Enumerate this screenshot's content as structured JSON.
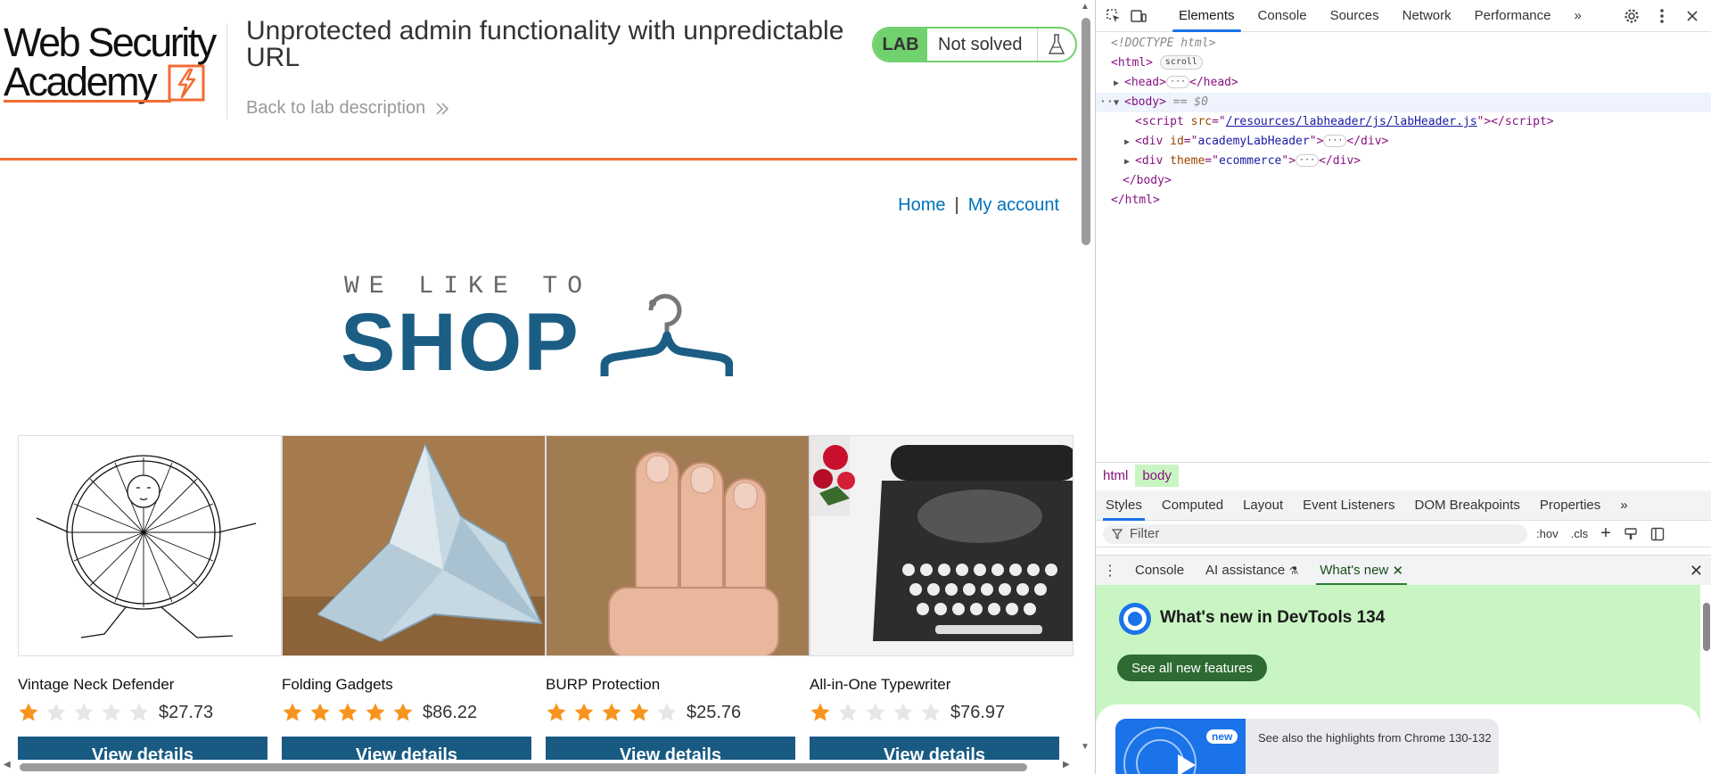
{
  "lab_header": {
    "logo_line1": "Web Security",
    "logo_line2": "Academy",
    "title": "Unprotected admin functionality with unpredictable URL",
    "back_link": "Back to lab description",
    "status_tag": "LAB",
    "status_text": "Not solved"
  },
  "nav": {
    "home": "Home",
    "separator": "|",
    "account": "My account"
  },
  "banner": {
    "small_text": "WE LIKE TO",
    "big_text": "SHOP"
  },
  "products": [
    {
      "name": "Vintage Neck Defender",
      "rating": 1,
      "price": "$27.73",
      "button": "View details"
    },
    {
      "name": "Folding Gadgets",
      "rating": 5,
      "price": "$86.22",
      "button": "View details"
    },
    {
      "name": "BURP Protection",
      "rating": 4,
      "price": "$25.76",
      "button": "View details"
    },
    {
      "name": "All-in-One Typewriter",
      "rating": 1,
      "price": "$76.97",
      "button": "View details"
    }
  ],
  "colors": {
    "accent_orange": "#f26c32",
    "brand_blue": "#185a82",
    "link_blue": "#0071bc",
    "lab_green": "#70d16d",
    "star_orange": "#f7941d",
    "star_empty": "#e6e6e6"
  },
  "devtools": {
    "main_tabs": [
      "Elements",
      "Console",
      "Sources",
      "Network",
      "Performance"
    ],
    "active_tab": "Elements",
    "more_tabs": "»",
    "dom": {
      "doctype": "<!DOCTYPE html>",
      "html_open": "<html>",
      "scroll_badge": "scroll",
      "head": "<head>",
      "head_close": "</head>",
      "body_open": "<body>",
      "body_selected_marker": "== $0",
      "script_src": "/resources/labheader/js/labHeader.js",
      "div1_id": "academyLabHeader",
      "div2_theme": "ecommerce",
      "body_close": "</body>",
      "html_close": "</html>"
    },
    "breadcrumbs": [
      "html",
      "body"
    ],
    "sub_tabs": [
      "Styles",
      "Computed",
      "Layout",
      "Event Listeners",
      "DOM Breakpoints",
      "Properties"
    ],
    "filter_placeholder": "Filter",
    "filter_tools": [
      ":hov",
      ".cls"
    ],
    "drawer_tabs": [
      "Console",
      "AI assistance",
      "What's new"
    ],
    "whats_new": {
      "title": "What's new in DevTools 134",
      "button": "See all new features",
      "badge": "new",
      "caption": "See also the highlights from Chrome 130-132"
    }
  }
}
